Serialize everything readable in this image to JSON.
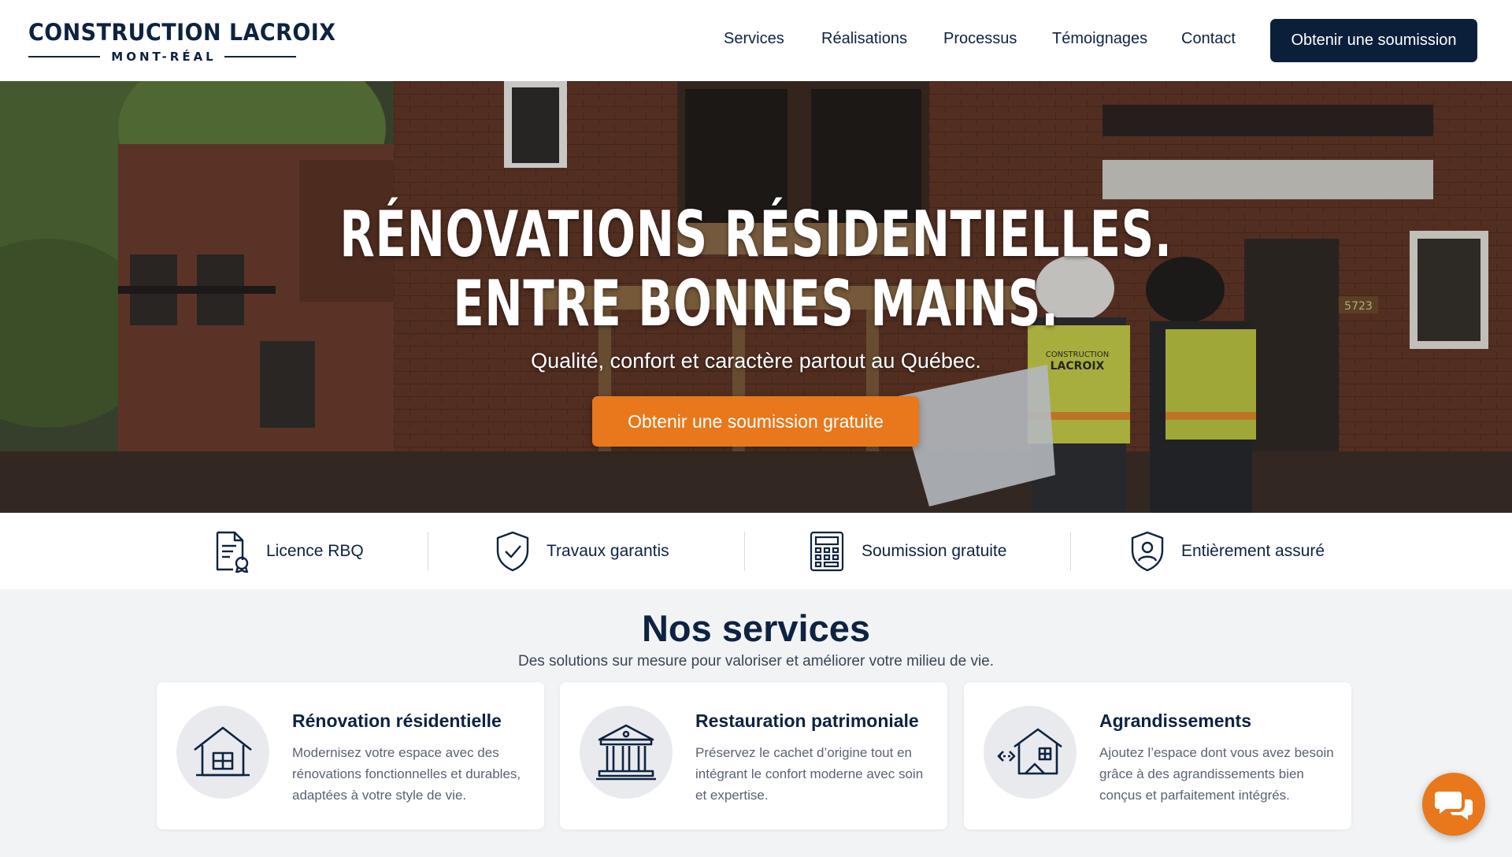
{
  "brand": {
    "name": "CONSTRUCTION LACROIX",
    "subtitle": "MONT-RÉAL"
  },
  "nav": {
    "items": [
      {
        "label": "Services"
      },
      {
        "label": "Réalisations"
      },
      {
        "label": "Processus"
      },
      {
        "label": "Témoignages"
      },
      {
        "label": "Contact"
      }
    ],
    "cta_label": "Obtenir une soumission"
  },
  "hero": {
    "title_line1": "RÉNOVATIONS RÉSIDENTIELLES.",
    "title_line2": "ENTRE BONNES MAINS.",
    "subtitle": "Qualité, confort et caractère partout au Québec.",
    "cta_label": "Obtenir une soumission gratuite",
    "image_text": {
      "vest_brand_top": "CONSTRUCTION",
      "vest_brand_bottom": "LACROIX",
      "house_number": "5723"
    }
  },
  "trust": [
    {
      "label": "Licence RBQ",
      "icon": "certificate-icon"
    },
    {
      "label": "Travaux garantis",
      "icon": "shield-check-icon"
    },
    {
      "label": "Soumission gratuite",
      "icon": "calculator-icon"
    },
    {
      "label": "Entièrement assuré",
      "icon": "shield-person-icon"
    }
  ],
  "services": {
    "title": "Nos services",
    "subtitle": "Des solutions sur mesure pour valoriser et améliorer votre milieu de vie.",
    "cards": [
      {
        "title": "Rénovation résidentielle",
        "description": "Modernisez votre espace avec des rénovations fonctionnelles et durables, adaptées à votre style de vie.",
        "icon": "house-icon"
      },
      {
        "title": "Restauration patrimoniale",
        "description": "Préservez le cachet d’origine tout en intégrant le confort moderne avec soin et expertise.",
        "icon": "heritage-building-icon"
      },
      {
        "title": "Agrandissements",
        "description": "Ajoutez l’espace dont vous avez besoin grâce à des agrandissements bien conçus et parfaitement intégrés.",
        "icon": "house-extension-icon"
      }
    ]
  },
  "colors": {
    "navy": "#0b1f3a",
    "accent_orange": "#e8781b",
    "background": "#f1f3f5"
  }
}
